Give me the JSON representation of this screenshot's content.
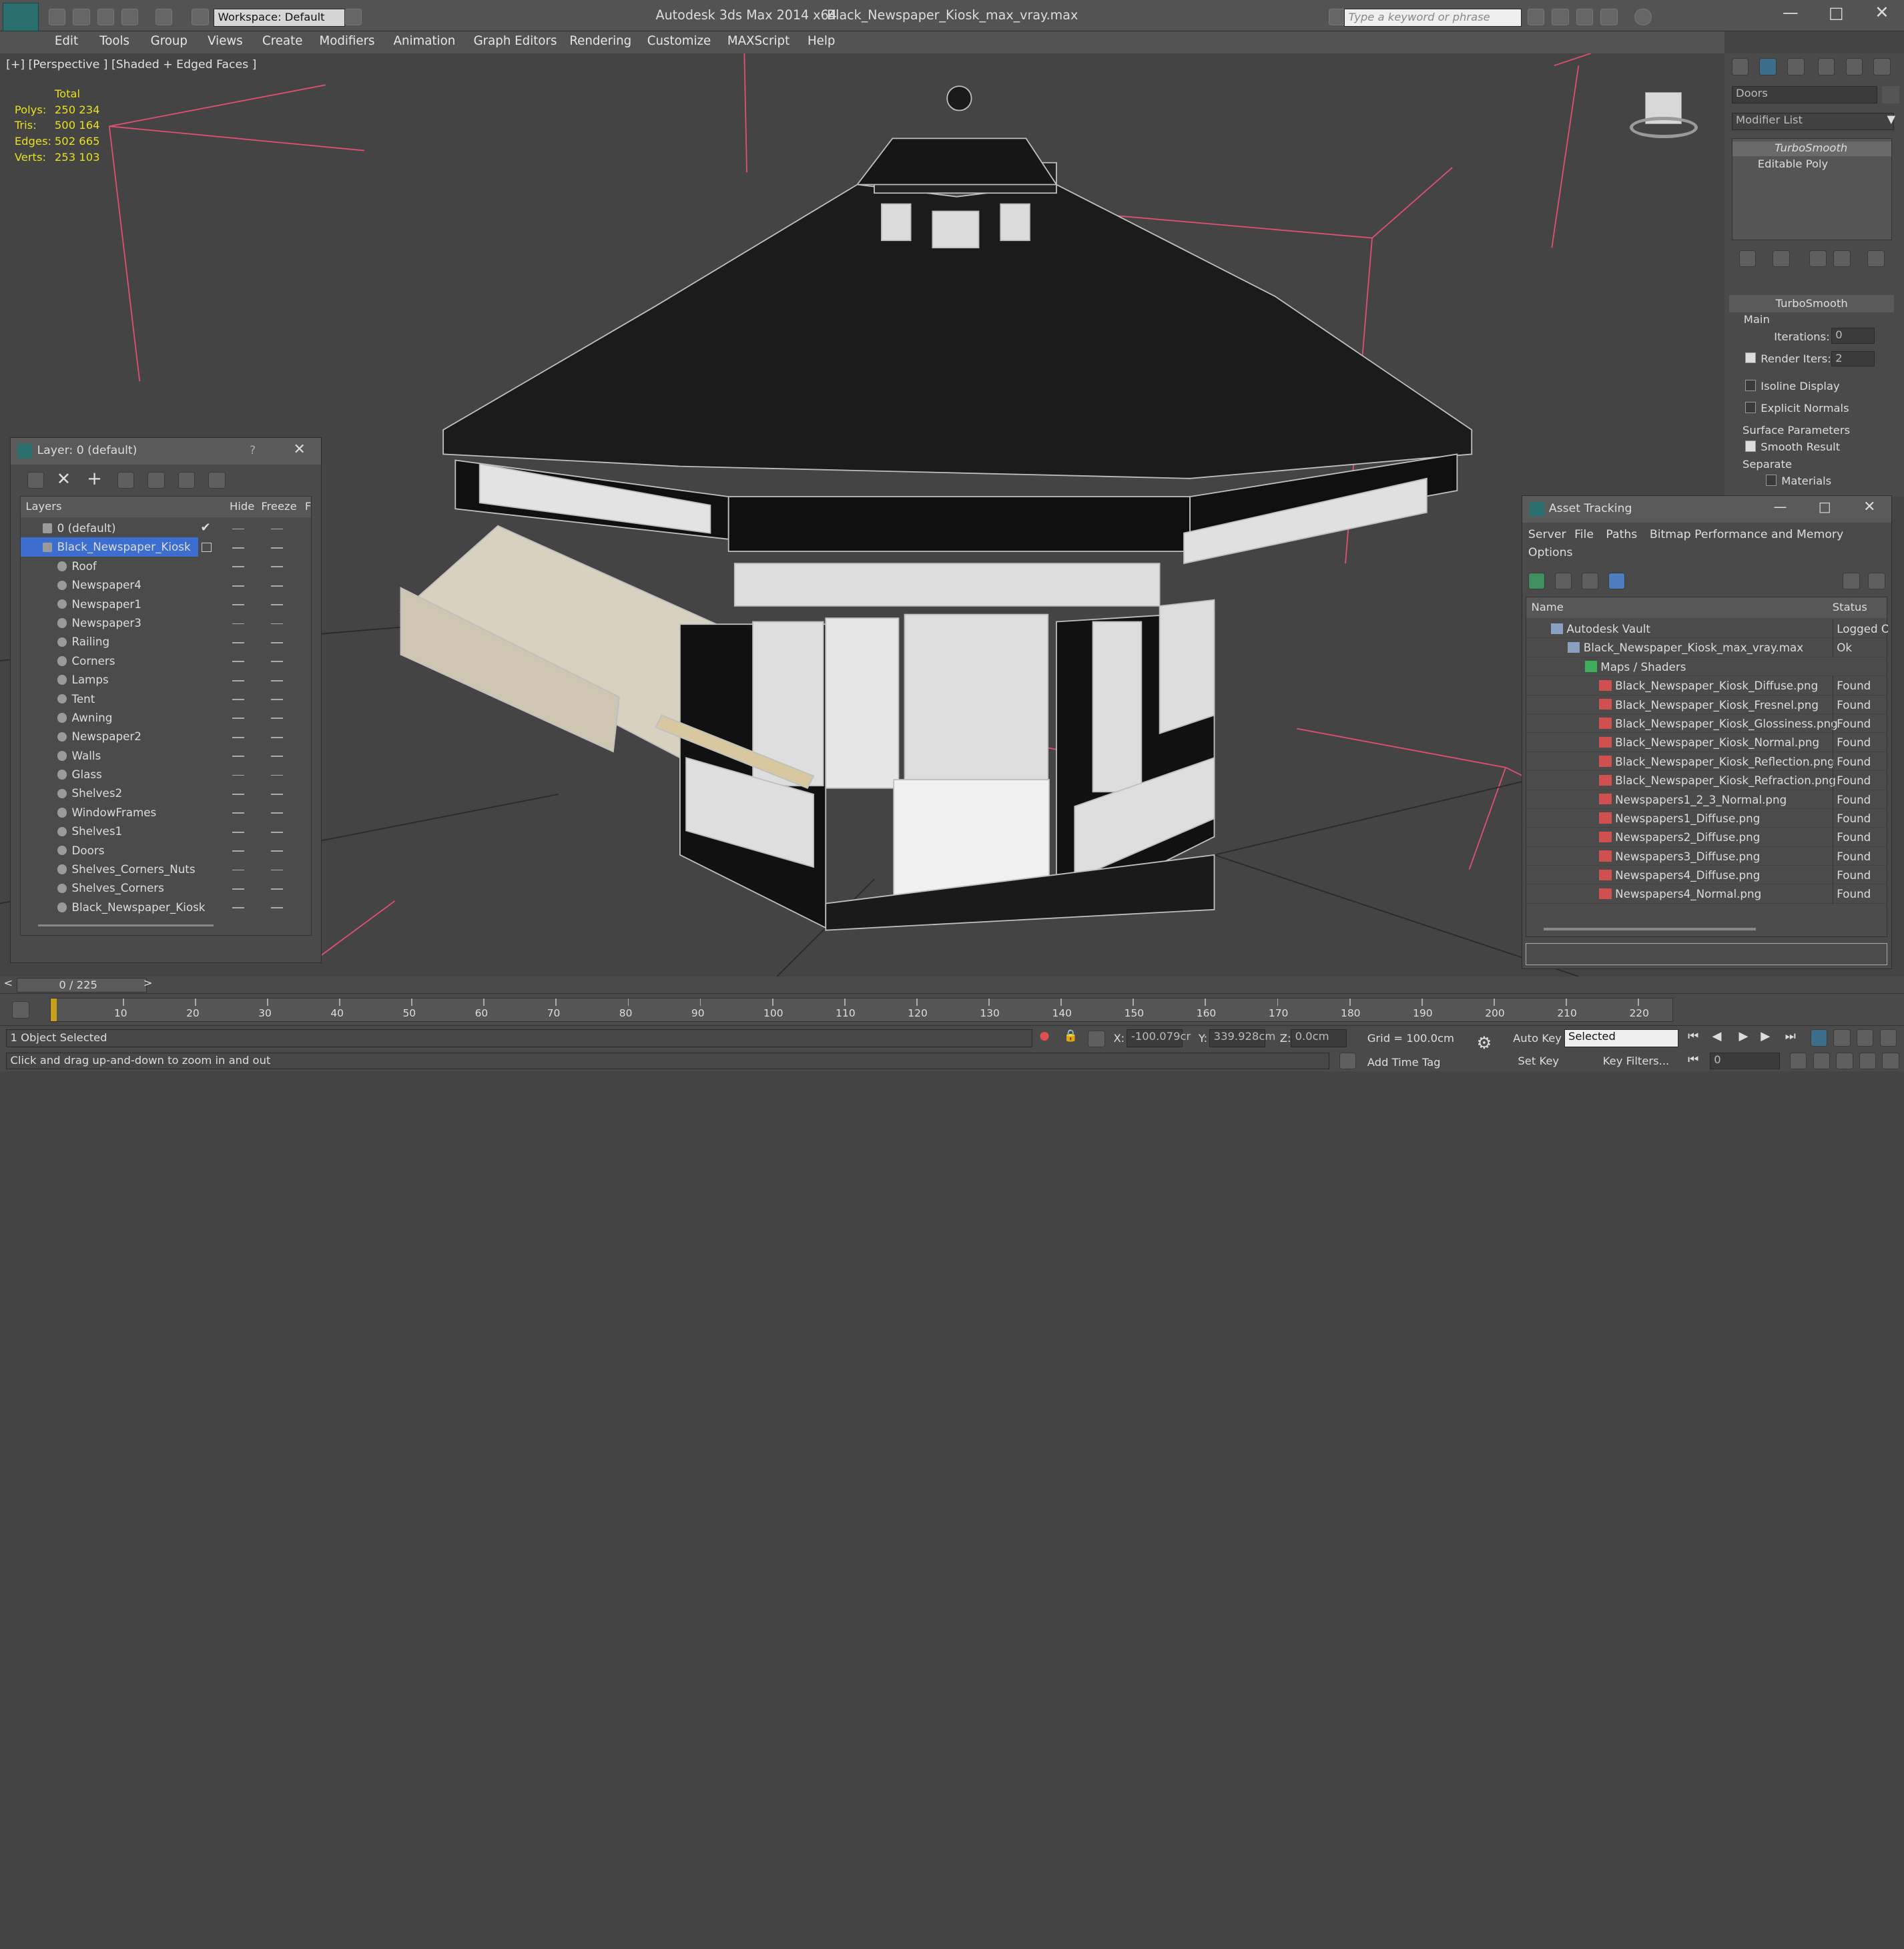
{
  "title_bar": {
    "workspace": "Workspace: Default",
    "app_title": "Autodesk 3ds Max  2014 x64",
    "file_title": "Black_Newspaper_Kiosk_max_vray.max",
    "search_placeholder": "Type a keyword or phrase"
  },
  "menu": [
    "Edit",
    "Tools",
    "Group",
    "Views",
    "Create",
    "Modifiers",
    "Animation",
    "Graph Editors",
    "Rendering",
    "Customize",
    "MAXScript",
    "Help"
  ],
  "viewport": {
    "label": "[+] [Perspective ] [Shaded + Edged Faces ]",
    "stats_header": "Total",
    "stats": [
      {
        "label": "Polys:",
        "value": "250 234"
      },
      {
        "label": "Tris:",
        "value": "500 164"
      },
      {
        "label": "Edges:",
        "value": "502 665"
      },
      {
        "label": "Verts:",
        "value": "253 103"
      }
    ]
  },
  "layer_panel": {
    "title": "Layer: 0 (default)",
    "help": "?",
    "columns": [
      "Layers",
      "Hide",
      "Freeze",
      "F"
    ],
    "rows": [
      "0 (default)",
      "Black_Newspaper_Kiosk",
      "Roof",
      "Newspaper4",
      "Newspaper1",
      "Newspaper3",
      "Railing",
      "Corners",
      "Lamps",
      "Tent",
      "Awning",
      "Newspaper2",
      "Walls",
      "Glass",
      "Shelves2",
      "WindowFrames",
      "Shelves1",
      "Doors",
      "Shelves_Corners_Nuts",
      "Shelves_Corners",
      "Black_Newspaper_Kiosk"
    ]
  },
  "command_panel": {
    "object_name": "Doors",
    "modifier_list": "Modifier List",
    "stack": [
      "TurboSmooth",
      "Editable Poly"
    ],
    "rollout": "TurboSmooth",
    "group_main": "Main",
    "iterations_label": "Iterations:",
    "iterations": "0",
    "render_iters_label": "Render Iters:",
    "render_iters": "2",
    "isoline": "Isoline Display",
    "explicit_normals": "Explicit Normals",
    "surface_params": "Surface Parameters",
    "smooth_result": "Smooth Result",
    "separate": "Separate",
    "materials": "Materials"
  },
  "asset_tracking": {
    "title": "Asset Tracking",
    "menu": [
      "Server",
      "File",
      "Paths",
      "Bitmap Performance and Memory",
      "Options"
    ],
    "columns": [
      "Name",
      "Status"
    ],
    "rows": [
      {
        "name": "Autodesk Vault",
        "status": "Logged Ou"
      },
      {
        "name": "Black_Newspaper_Kiosk_max_vray.max",
        "status": "Ok"
      },
      {
        "name": "Maps / Shaders",
        "status": ""
      },
      {
        "name": "Black_Newspaper_Kiosk_Diffuse.png",
        "status": "Found"
      },
      {
        "name": "Black_Newspaper_Kiosk_Fresnel.png",
        "status": "Found"
      },
      {
        "name": "Black_Newspaper_Kiosk_Glossiness.png",
        "status": "Found"
      },
      {
        "name": "Black_Newspaper_Kiosk_Normal.png",
        "status": "Found"
      },
      {
        "name": "Black_Newspaper_Kiosk_Reflection.png",
        "status": "Found"
      },
      {
        "name": "Black_Newspaper_Kiosk_Refraction.png",
        "status": "Found"
      },
      {
        "name": "Newspapers1_2_3_Normal.png",
        "status": "Found"
      },
      {
        "name": "Newspapers1_Diffuse.png",
        "status": "Found"
      },
      {
        "name": "Newspapers2_Diffuse.png",
        "status": "Found"
      },
      {
        "name": "Newspapers3_Diffuse.png",
        "status": "Found"
      },
      {
        "name": "Newspapers4_Diffuse.png",
        "status": "Found"
      },
      {
        "name": "Newspapers4_Normal.png",
        "status": "Found"
      }
    ]
  },
  "timeline": {
    "frame": "0 / 225",
    "ticks": [
      "10",
      "20",
      "30",
      "40",
      "50",
      "60",
      "70",
      "80",
      "90",
      "100",
      "110",
      "120",
      "130",
      "140",
      "150",
      "160",
      "170",
      "180",
      "190",
      "200",
      "210",
      "220"
    ]
  },
  "status": {
    "selected": "1 Object Selected",
    "prompt": "Click and drag up-and-down to zoom in and out",
    "x_label": "X:",
    "x": "-100.079cr",
    "y_label": "Y:",
    "y": "339.928cm",
    "z_label": "Z:",
    "z": "0.0cm",
    "grid": "Grid = 100.0cm",
    "auto_key": "Auto Key",
    "selected_dropdown": "Selected",
    "set_key": "Set Key",
    "key_filters": "Key Filters...",
    "add_time_tag": "Add Time Tag",
    "frame_field": "0"
  }
}
